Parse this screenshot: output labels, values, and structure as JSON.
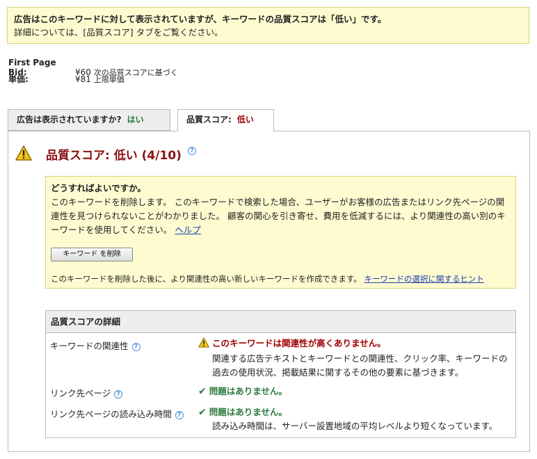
{
  "banner": {
    "line1": "広告はこのキーワードに対して表示されていますが、キーワードの品質スコアは「低い」です。",
    "line2": "詳細については、[品質スコア] タブをご覧ください。"
  },
  "bids": {
    "first_page_label": "First Page Bid:",
    "first_page_value": "¥60",
    "first_page_note": "次の品質スコアに基づく",
    "cpc_label": "単価:",
    "cpc_value": "¥81",
    "cpc_note": "上限単価"
  },
  "tabs": [
    {
      "label": "広告は表示されていますか?",
      "value": "はい"
    },
    {
      "label": "品質スコア:",
      "value": "低い"
    }
  ],
  "quality": {
    "title": "品質スコア: 低い (4/10)"
  },
  "advice": {
    "heading": "どうすればよいですか。",
    "body": "このキーワードを削除します。 このキーワードで検索した場合、ユーザーがお客様の広告またはリンク先ページの関連性を見つけられないことがわかりました。 顧客の関心を引き寄せ、費用を低減するには、より関連性の高い別のキーワードを使用してください。",
    "help_link": "ヘルプ",
    "delete_button": "キーワード        を削除",
    "footer": "このキーワードを削除した後に、より関連性の高い新しいキーワードを作成できます。",
    "footer_link": "キーワードの選択に関するヒント"
  },
  "details": {
    "heading": "品質スコアの詳細",
    "rows": [
      {
        "label": "キーワードの関連性",
        "status": "このキーワードは関連性が高くありません。",
        "description": "関連する広告テキストとキーワードとの関連性、クリック率、キーワードの過去の使用状況、掲載結果に関するその他の要素に基づきます。"
      },
      {
        "label": "リンク先ページ",
        "status": "問題はありません。",
        "description": ""
      },
      {
        "label": "リンク先ページの読み込み時間",
        "status": "問題はありません。",
        "description": "読み込み時間は、サーバー設置地域の平均レベルより短くなっています。"
      }
    ]
  },
  "colors": {
    "warning_bg": "#fefbd1",
    "bad": "#a00000",
    "good": "#2c7a3c",
    "link": "#1a3fb0"
  }
}
